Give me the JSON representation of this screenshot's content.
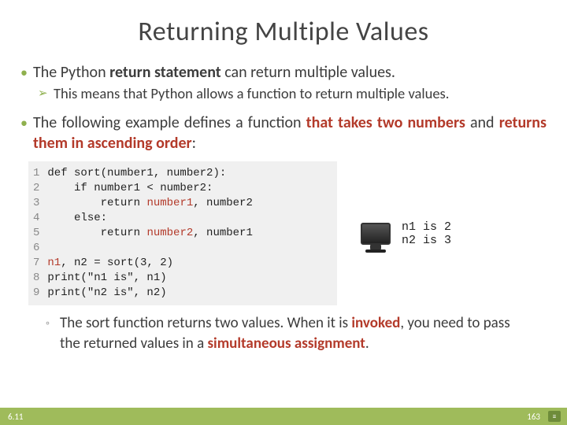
{
  "title": "Returning Multiple Values",
  "p1_pre": "The Python ",
  "p1_b": "return statement",
  "p1_post": " can return multiple values.",
  "p1_sub": "This means that Python allows a function to return multiple values.",
  "p2_a": "The following example defines a function ",
  "p2_b1": "that takes two numbers",
  "p2_c": " and ",
  "p2_b2": "returns them in ascending order",
  "p2_d": ":",
  "code": {
    "ln": "1\n2\n3\n4\n5\n6\n7\n8\n9",
    "body": "def sort(number1, number2):\n    if number1 < number2:\n        return <span class=\"var\">number1</span>, number2\n    else:\n        return <span class=\"var\">number2</span>, number1\n\n<span class=\"var\">n1</span>, n2 = sort(3, 2)\nprint(\"n1 is\", n1)\nprint(\"n2 is\", n2)"
  },
  "output": "n1 is 2\nn2 is 3",
  "closing_a": "The sort function returns two values. When it is ",
  "closing_b1": "invoked",
  "closing_c": ", you need to pass the returned values in a ",
  "closing_b2": "simultaneous assignment",
  "closing_d": ".",
  "footer_left": "6.11",
  "footer_page": "163"
}
